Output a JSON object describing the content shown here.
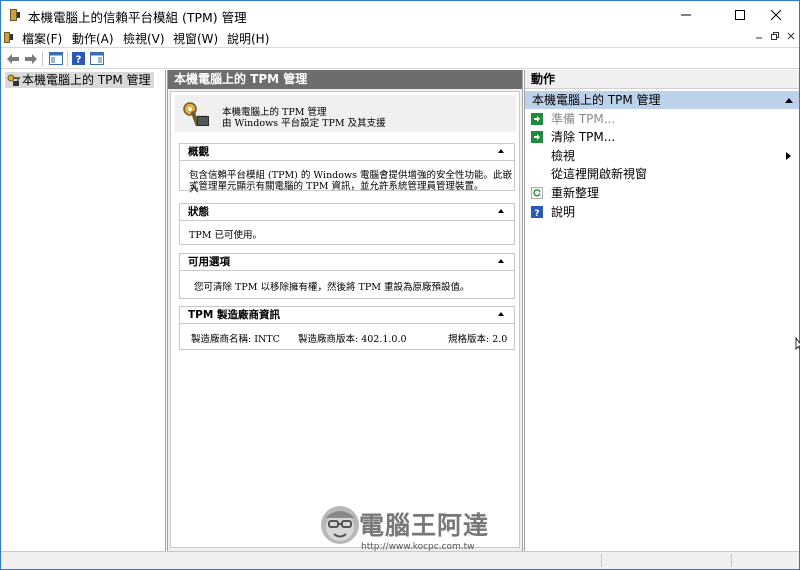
{
  "window": {
    "title": "本機電腦上的信賴平台模組 (TPM) 管理",
    "controls": [
      "minimize-icon",
      "maximize-icon",
      "close-icon"
    ]
  },
  "menubar": {
    "items": [
      "檔案(F)",
      "動作(A)",
      "檢視(V)",
      "視窗(W)",
      "說明(H)"
    ]
  },
  "toolbar": {
    "buttons": [
      "back-arrow-icon",
      "forward-arrow-icon",
      "show-hide-console-tree-icon",
      "help-icon",
      "show-action-pane-icon"
    ]
  },
  "tree": {
    "root_label": "本機電腦上的 TPM 管理"
  },
  "center": {
    "header": "本機電腦上的 TPM 管理",
    "intro_title": "本機電腦上的 TPM 管理",
    "intro_subtitle": "由 Windows 平台設定 TPM 及其支援",
    "sections": [
      {
        "title": "概觀",
        "lines": [
          "包含信賴平台模組 (TPM) 的 Windows 電腦會提供增強的安全性功能。此嵌入",
          "式管理單元顯示有關電腦的 TPM 資訊，並允許系統管理員管理裝置。"
        ]
      },
      {
        "title": "狀態",
        "text": "TPM 已可使用。"
      },
      {
        "title": "可用選項",
        "text": "您可清除 TPM 以移除擁有權，然後將 TPM 重設為原廠預設值。"
      },
      {
        "title": "TPM 製造廠商資訊",
        "manufacturer_name": "製造廠商名稱: INTC",
        "manufacturer_version": "製造廠商版本: 402.1.0.0",
        "spec_version": "規格版本: 2.0"
      }
    ]
  },
  "actions": {
    "header": "動作",
    "group_title": "本機電腦上的 TPM 管理",
    "items": [
      {
        "label": "準備 TPM...",
        "icon": "prepare-tpm-icon",
        "enabled": false
      },
      {
        "label": "清除 TPM...",
        "icon": "clear-tpm-icon",
        "enabled": true
      },
      {
        "label": "檢視",
        "icon": "",
        "enabled": true,
        "submenu": true
      },
      {
        "label": "從這裡開啟新視窗",
        "icon": "",
        "enabled": true
      },
      {
        "label": "重新整理",
        "icon": "refresh-icon",
        "enabled": true
      },
      {
        "label": "說明",
        "icon": "help-icon",
        "enabled": true
      }
    ]
  },
  "watermark": {
    "brand": "電腦王阿達",
    "url": "http://www.kocpc.com.tw"
  },
  "colors": {
    "window_border": "#2b79d6",
    "pane_header": "#6d6d6d",
    "action_group_bg": "#bcd2ea",
    "disabled_text": "#8a8a8a",
    "action_icon_green": "#1e8c3a"
  }
}
